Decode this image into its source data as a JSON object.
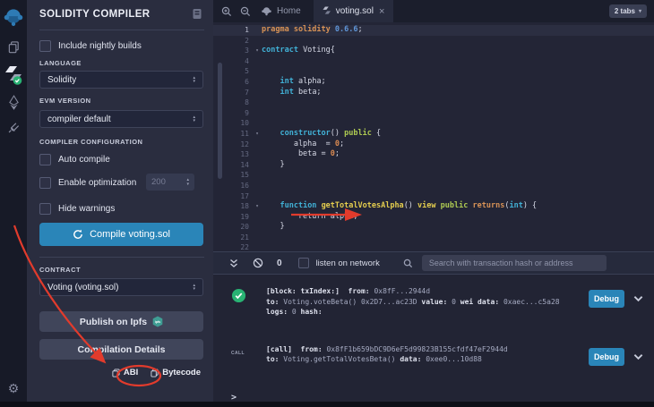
{
  "colors": {
    "accent_blue": "#2a85b8",
    "success_green": "#29b273",
    "annotation_red": "#e23b2c",
    "ipfs_teal": "#3f9e94",
    "button_gray": "#40455a"
  },
  "rail": {
    "icons": [
      "remix-logo",
      "file-explorer",
      "solidity-compiler",
      "deploy-and-run",
      "plugin-manager",
      "settings"
    ]
  },
  "sidebar": {
    "title": "SOLIDITY COMPILER",
    "nightly_label": "Include nightly builds",
    "language_label": "LANGUAGE",
    "language_value": "Solidity",
    "evm_label": "EVM VERSION",
    "evm_value": "compiler default",
    "config_label": "COMPILER CONFIGURATION",
    "auto_compile_label": "Auto compile",
    "optimization_label": "Enable optimization",
    "optimization_value": "200",
    "hide_warnings_label": "Hide warnings",
    "compile_label": "Compile voting.sol",
    "contract_label": "CONTRACT",
    "contract_value": "Voting (voting.sol)",
    "publish_label": "Publish on Ipfs",
    "ipfs_badge": "ipfs",
    "details_label": "Compilation Details",
    "abi_label": "ABI",
    "bytecode_label": "Bytecode"
  },
  "tabbar": {
    "home_label": "Home",
    "file_tab": "voting.sol",
    "tabs_count": "2 tabs"
  },
  "editor": {
    "token_colors": {
      "kw": "#41b1d6",
      "fn": "#e4cd4e",
      "pub": "#aeca52",
      "ret": "#d99356",
      "ver": "#6096d8",
      "num": "#d98a52",
      "pl": "#d6d9e6"
    },
    "lines": [
      {
        "n": 1,
        "hl": true,
        "tokens": [
          [
            "ret",
            "pragma solidity "
          ],
          [
            "ver",
            "0.6.6"
          ],
          [
            "pl",
            ";"
          ]
        ]
      },
      {
        "n": 2,
        "tokens": []
      },
      {
        "n": 3,
        "fold": true,
        "tokens": [
          [
            "kw",
            "contract "
          ],
          [
            "pl",
            "Voting{"
          ]
        ]
      },
      {
        "n": 4,
        "tokens": []
      },
      {
        "n": 5,
        "tokens": []
      },
      {
        "n": 6,
        "tokens": [
          [
            "pl",
            "    "
          ],
          [
            "kw",
            "int"
          ],
          [
            "pl",
            " alpha;"
          ]
        ]
      },
      {
        "n": 7,
        "tokens": [
          [
            "pl",
            "    "
          ],
          [
            "kw",
            "int"
          ],
          [
            "pl",
            " beta;"
          ]
        ]
      },
      {
        "n": 8,
        "tokens": []
      },
      {
        "n": 9,
        "tokens": []
      },
      {
        "n": 10,
        "tokens": []
      },
      {
        "n": 11,
        "fold": true,
        "tokens": [
          [
            "pl",
            "    "
          ],
          [
            "kw",
            "constructor"
          ],
          [
            "pl",
            "() "
          ],
          [
            "pub",
            "public"
          ],
          [
            "pl",
            " {"
          ]
        ]
      },
      {
        "n": 12,
        "tokens": [
          [
            "pl",
            "       alpha  = "
          ],
          [
            "num",
            "0"
          ],
          [
            "pl",
            ";"
          ]
        ]
      },
      {
        "n": 13,
        "tokens": [
          [
            "pl",
            "        beta = "
          ],
          [
            "num",
            "0"
          ],
          [
            "pl",
            ";"
          ]
        ]
      },
      {
        "n": 14,
        "tokens": [
          [
            "pl",
            "    }"
          ]
        ]
      },
      {
        "n": 15,
        "tokens": []
      },
      {
        "n": 16,
        "tokens": []
      },
      {
        "n": 17,
        "tokens": []
      },
      {
        "n": 18,
        "fold": true,
        "tokens": [
          [
            "pl",
            "    "
          ],
          [
            "kw",
            "function"
          ],
          [
            "pl",
            " "
          ],
          [
            "fn",
            "getTotalVotesAlpha"
          ],
          [
            "pl",
            "() "
          ],
          [
            "fn",
            "view"
          ],
          [
            "pl",
            " "
          ],
          [
            "pub",
            "public"
          ],
          [
            "pl",
            " "
          ],
          [
            "ret",
            "returns"
          ],
          [
            "pl",
            "("
          ],
          [
            "kw",
            "int"
          ],
          [
            "pl",
            ") {"
          ]
        ]
      },
      {
        "n": 19,
        "tokens": [
          [
            "pl",
            "        return alpha;"
          ]
        ]
      },
      {
        "n": 20,
        "tokens": [
          [
            "pl",
            "    }"
          ]
        ]
      },
      {
        "n": 21,
        "tokens": []
      },
      {
        "n": 22,
        "tokens": []
      }
    ]
  },
  "terminal": {
    "pending_count": "0",
    "listen_label": "listen on network",
    "search_placeholder": "Search with transaction hash or address",
    "prompt": ">",
    "entries": [
      {
        "icon": "check",
        "debug_label": "Debug",
        "lines": [
          [
            [
              "b",
              "[block: txIndex:]"
            ],
            [
              "n",
              "  "
            ],
            [
              "b",
              "from:"
            ],
            [
              "n",
              " 0x8fF...2944d"
            ]
          ],
          [
            [
              "b",
              "to:"
            ],
            [
              "n",
              " Voting.voteBeta() 0x2D7...ac23D "
            ],
            [
              "b",
              "value:"
            ],
            [
              "n",
              " 0 "
            ],
            [
              "b",
              "wei"
            ],
            [
              "n",
              " "
            ],
            [
              "b",
              "data:"
            ],
            [
              "n",
              " 0xaec...c5a28"
            ]
          ],
          [
            [
              "b",
              "logs:"
            ],
            [
              "n",
              " 0 "
            ],
            [
              "b",
              "hash:"
            ]
          ]
        ]
      },
      {
        "icon": "call",
        "icon_label": "CALL",
        "debug_label": "Debug",
        "lines": [
          [
            [
              "b",
              "[call]"
            ],
            [
              "n",
              "  "
            ],
            [
              "b",
              "from:"
            ],
            [
              "n",
              " 0x8fF1b659bDC9D6eF5d99823B155cfdf47eF2944d"
            ]
          ],
          [
            [
              "b",
              "to:"
            ],
            [
              "n",
              " Voting.getTotalVotesBeta() "
            ],
            [
              "b",
              "data:"
            ],
            [
              "n",
              " 0xee0...10d88"
            ]
          ]
        ]
      }
    ]
  }
}
